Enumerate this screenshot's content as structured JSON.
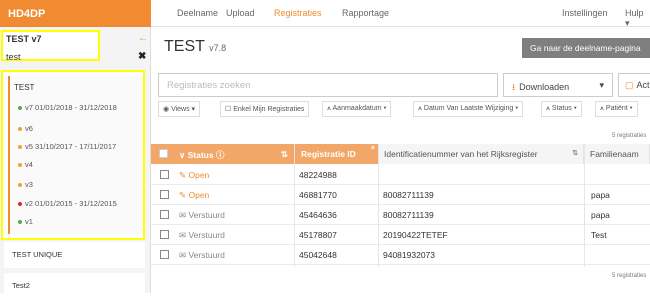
{
  "brand": "HD4DP",
  "nav": {
    "deelname": "Deelname",
    "upload": "Upload",
    "registraties": "Registraties",
    "rapportage": "Rapportage",
    "instellingen": "Instellingen",
    "hulp": "Hulp"
  },
  "sidebar": {
    "project_title": "TEST v7",
    "project_sub": "test",
    "list_head": "TEST",
    "versions": [
      {
        "label": "v7 01/01/2018 - 31/12/2018",
        "color": "#4caf50"
      },
      {
        "label": "v6",
        "color": "#f0a030"
      },
      {
        "label": "v5 31/10/2017 - 17/11/2017",
        "color": "#f0a030"
      },
      {
        "label": "v4",
        "color": "#f0a030"
      },
      {
        "label": "v3",
        "color": "#f0a030"
      },
      {
        "label": "v2 01/01/2015 - 31/12/2015",
        "color": "#d32f2f"
      },
      {
        "label": "v1",
        "color": "#4caf50"
      }
    ],
    "items": [
      "TEST UNIQUE",
      "Test2"
    ]
  },
  "main": {
    "title": "TEST",
    "version": "v7.8",
    "go_button": "Ga naar de deelname-pagina",
    "search_placeholder": "Registraties zoeken",
    "download": "Downloaden",
    "actions": "Acti",
    "filters": {
      "views": "Views",
      "mine": "Enkel Mijn Registraties",
      "aanmaak": "Aanmaakdatum",
      "datum": "Datum Van Laatste Wijziging",
      "status": "Status",
      "patient": "Patiënt"
    },
    "count_top": "5 registraties",
    "count_bottom": "5 registraties"
  },
  "table": {
    "headers": {
      "status": "Status",
      "reg_id": "Registratie ID",
      "rijks": "Identificatienummer van het Rijksregister",
      "familie": "Familienaam"
    },
    "rows": [
      {
        "status": "Open",
        "kind": "open",
        "id": "48224988",
        "rijks": "",
        "familie": ""
      },
      {
        "status": "Open",
        "kind": "open",
        "id": "46881770",
        "rijks": "80082711139",
        "familie": "papa"
      },
      {
        "status": "Verstuurd",
        "kind": "sent",
        "id": "45464636",
        "rijks": "80082711139",
        "familie": "papa"
      },
      {
        "status": "Verstuurd",
        "kind": "sent",
        "id": "45178807",
        "rijks": "20190422TETEF",
        "familie": "Test"
      },
      {
        "status": "Verstuurd",
        "kind": "sent",
        "id": "45042648",
        "rijks": "94081932073",
        "familie": ""
      }
    ]
  },
  "colors": {
    "accent": "#f08b32",
    "highlight": "#ffff00"
  }
}
